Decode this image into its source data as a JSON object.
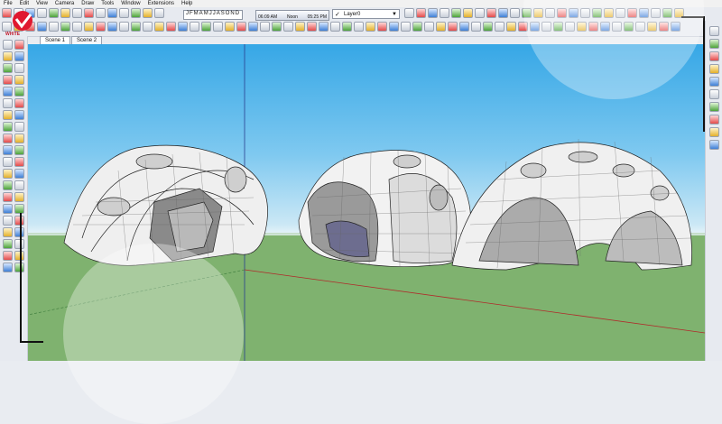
{
  "menu": [
    "File",
    "Edit",
    "View",
    "Camera",
    "Draw",
    "Tools",
    "Window",
    "Extensions",
    "Help"
  ],
  "shadow_months": [
    "J",
    "F",
    "M",
    "A",
    "M",
    "J",
    "J",
    "A",
    "S",
    "O",
    "N",
    "D"
  ],
  "time_slider": {
    "start": "06:09 AM",
    "mid": "Noon",
    "end": "05:25 PM"
  },
  "layer": {
    "current": "Layer0"
  },
  "tabs": [
    "Scene 1",
    "Scene 2"
  ],
  "logo": {
    "text": "WHITE"
  },
  "colors": {
    "sky_top": "#36a7e6",
    "sky_bottom": "#d6ecf6",
    "ground": "#7fb26f",
    "toolbar": "#e7eaf0",
    "brand": "#e0182f"
  }
}
